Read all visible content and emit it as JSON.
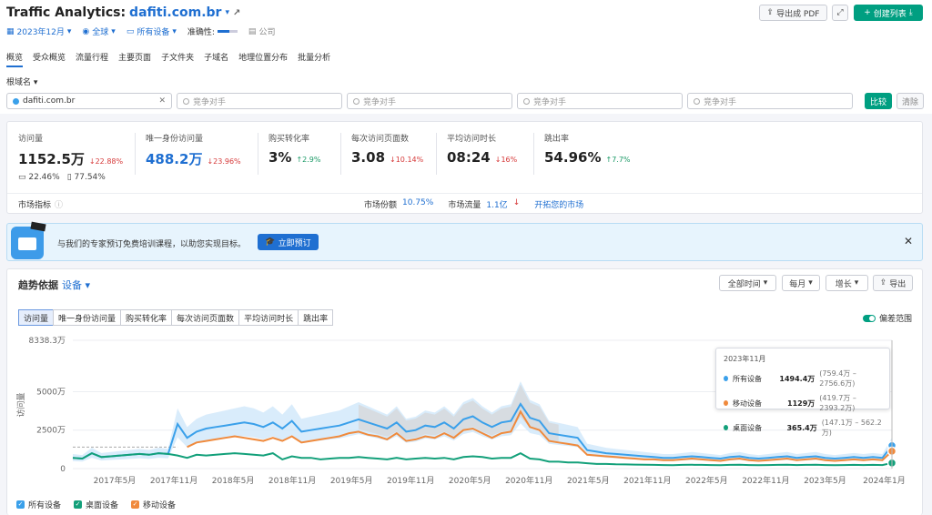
{
  "header": {
    "title": "Traffic Analytics:",
    "domain": "dafiti.com.br",
    "export_pdf": "导出成 PDF",
    "create_list": "创建列表"
  },
  "filters": {
    "date": "2023年12月",
    "region": "全球",
    "device": "所有设备",
    "accuracy_label": "准确性:",
    "company": "公司"
  },
  "tabs": [
    "概览",
    "受众概览",
    "流量行程",
    "主要页面",
    "子文件夹",
    "子域名",
    "地理位置分布",
    "批量分析"
  ],
  "root_domain": "根域名",
  "compare": {
    "first": "dafiti.com.br",
    "placeholder": "竞争对手",
    "compare_btn": "比较",
    "clear_btn": "清除"
  },
  "metrics": [
    {
      "label": "访问量",
      "value": "1152.5万",
      "change": "22.88%",
      "dir": "down",
      "desktop": "22.46%",
      "mobile": "77.54%"
    },
    {
      "label": "唯一身份访问量",
      "value": "488.2万",
      "change": "23.96%",
      "dir": "down"
    },
    {
      "label": "购买转化率",
      "value": "3%",
      "change": "2.9%",
      "dir": "up"
    },
    {
      "label": "每次访问页面数",
      "value": "3.08",
      "change": "10.14%",
      "dir": "down"
    },
    {
      "label": "平均访问时长",
      "value": "08:24",
      "change": "16%",
      "dir": "down"
    },
    {
      "label": "跳出率",
      "value": "54.96%",
      "change": "7.7%",
      "dir": "up"
    }
  ],
  "market": {
    "label": "市场指标",
    "share_label": "市场份额",
    "share": "10.75%",
    "traffic_label": "市场流量",
    "traffic": "1.1亿",
    "expand": "开拓您的市场"
  },
  "banner": {
    "text": "与我们的专家预订免费培训课程，以助您实现目标。",
    "cta": "立即预订"
  },
  "trend": {
    "title": "趋势依据",
    "by": "设备",
    "range": "全部时间",
    "period": "每月",
    "mode": "增长",
    "export": "导出",
    "deviation": "偏差范围",
    "tabs": [
      "访问量",
      "唯一身份访问量",
      "购买转化率",
      "每次访问页面数",
      "平均访问时长",
      "跳出率"
    ]
  },
  "tooltip": {
    "date": "2023年11月",
    "rows": [
      {
        "name": "所有设备",
        "value": "1494.4万",
        "range": "(759.4万 – 2756.6万)",
        "color": "#3aa0ea"
      },
      {
        "name": "移动设备",
        "value": "1129万",
        "range": "(419.7万 – 2393.2万)",
        "color": "#f08a3c"
      },
      {
        "name": "桌面设备",
        "value": "365.4万",
        "range": "(147.1万 – 562.2万)",
        "color": "#13a07a"
      }
    ]
  },
  "chart_data": {
    "type": "line",
    "ylabel": "访问量",
    "y_ticks": [
      "8338.3万",
      "5000万",
      "2500万",
      "0"
    ],
    "ylim": [
      0,
      8338.3
    ],
    "x_ticks": [
      "2017年5月",
      "2017年11月",
      "2018年5月",
      "2018年11月",
      "2019年5月",
      "2019年11月",
      "2020年5月",
      "2020年11月",
      "2021年5月",
      "2021年11月",
      "2022年5月",
      "2022年11月",
      "2023年5月",
      "2024年1月"
    ],
    "x_start": "2017-01",
    "x_end": "2023-12",
    "series": [
      {
        "name": "所有设备",
        "color": "#3aa0ea",
        "values": [
          700,
          650,
          1000,
          750,
          800,
          850,
          900,
          950,
          900,
          1000,
          950,
          2900,
          2000,
          2400,
          2600,
          2700,
          2800,
          2900,
          3000,
          2900,
          2700,
          3000,
          2600,
          3100,
          2400,
          2500,
          2600,
          2700,
          2800,
          3000,
          3200,
          3000,
          2800,
          2600,
          3000,
          2400,
          2500,
          2800,
          2700,
          3000,
          2600,
          3200,
          3400,
          3000,
          2700,
          3000,
          3100,
          4200,
          3300,
          3100,
          2300,
          2200,
          2100,
          2000,
          1200,
          1100,
          1000,
          950,
          900,
          850,
          800,
          750,
          700,
          700,
          750,
          800,
          750,
          700,
          650,
          750,
          800,
          700,
          650,
          700,
          750,
          800,
          700,
          750,
          800,
          700,
          650,
          700,
          750,
          700,
          750,
          700,
          1494
        ]
      },
      {
        "name": "移动设备",
        "color": "#f08a3c",
        "values": [
          null,
          null,
          null,
          null,
          null,
          null,
          null,
          null,
          null,
          null,
          null,
          null,
          1400,
          1700,
          1800,
          1900,
          2000,
          2100,
          2000,
          1900,
          1800,
          2000,
          1800,
          2100,
          1700,
          1800,
          1900,
          2000,
          2100,
          2300,
          2400,
          2200,
          2100,
          1900,
          2300,
          1800,
          1900,
          2100,
          2000,
          2300,
          2000,
          2500,
          2600,
          2300,
          2000,
          2300,
          2400,
          3700,
          2700,
          2500,
          1800,
          1700,
          1600,
          1500,
          900,
          850,
          800,
          750,
          700,
          650,
          600,
          600,
          550,
          550,
          600,
          650,
          600,
          550,
          500,
          600,
          650,
          550,
          500,
          550,
          600,
          650,
          550,
          600,
          650,
          550,
          500,
          550,
          600,
          550,
          600,
          550,
          1129
        ]
      },
      {
        "name": "桌面设备",
        "color": "#13a07a",
        "values": [
          700,
          650,
          1000,
          750,
          800,
          850,
          900,
          950,
          900,
          1000,
          950,
          850,
          700,
          900,
          850,
          900,
          950,
          1000,
          950,
          900,
          850,
          1000,
          600,
          800,
          700,
          700,
          600,
          650,
          700,
          700,
          750,
          700,
          650,
          600,
          700,
          600,
          650,
          700,
          650,
          700,
          600,
          750,
          800,
          750,
          650,
          700,
          700,
          1000,
          650,
          600,
          450,
          450,
          400,
          400,
          350,
          300,
          300,
          280,
          270,
          260,
          250,
          240,
          230,
          220,
          240,
          250,
          240,
          230,
          220,
          240,
          250,
          230,
          220,
          230,
          240,
          250,
          230,
          240,
          250,
          230,
          220,
          230,
          240,
          230,
          240,
          230,
          365
        ]
      }
    ]
  },
  "legend": [
    "所有设备",
    "桌面设备",
    "移动设备"
  ]
}
